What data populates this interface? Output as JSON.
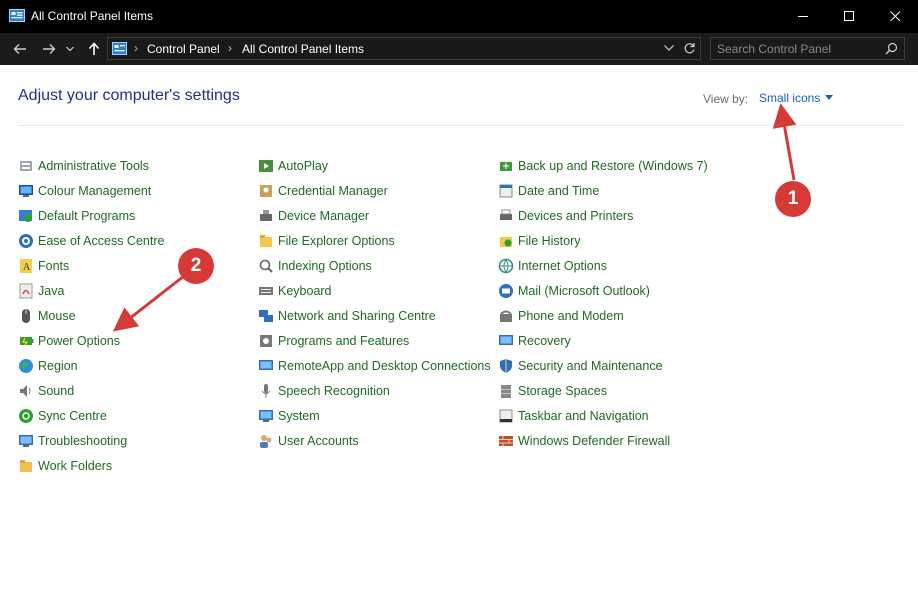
{
  "window": {
    "title": "All Control Panel Items"
  },
  "address": {
    "crumbs": [
      "Control Panel",
      "All Control Panel Items"
    ],
    "search_placeholder": "Search Control Panel"
  },
  "main": {
    "heading": "Adjust your computer's settings",
    "view_by_label": "View by:",
    "view_by_value": "Small icons"
  },
  "columns": [
    [
      {
        "label": "Administrative Tools",
        "icon": "administrative-tools-icon"
      },
      {
        "label": "Colour Management",
        "icon": "colour-management-icon"
      },
      {
        "label": "Default Programs",
        "icon": "default-programs-icon"
      },
      {
        "label": "Ease of Access Centre",
        "icon": "ease-of-access-icon"
      },
      {
        "label": "Fonts",
        "icon": "fonts-icon"
      },
      {
        "label": "Java",
        "icon": "java-icon"
      },
      {
        "label": "Mouse",
        "icon": "mouse-icon"
      },
      {
        "label": "Power Options",
        "icon": "power-options-icon"
      },
      {
        "label": "Region",
        "icon": "region-icon"
      },
      {
        "label": "Sound",
        "icon": "sound-icon"
      },
      {
        "label": "Sync Centre",
        "icon": "sync-centre-icon"
      },
      {
        "label": "Troubleshooting",
        "icon": "troubleshooting-icon"
      },
      {
        "label": "Work Folders",
        "icon": "work-folders-icon"
      }
    ],
    [
      {
        "label": "AutoPlay",
        "icon": "autoplay-icon"
      },
      {
        "label": "Credential Manager",
        "icon": "credential-manager-icon"
      },
      {
        "label": "Device Manager",
        "icon": "device-manager-icon"
      },
      {
        "label": "File Explorer Options",
        "icon": "file-explorer-options-icon"
      },
      {
        "label": "Indexing Options",
        "icon": "indexing-options-icon"
      },
      {
        "label": "Keyboard",
        "icon": "keyboard-icon"
      },
      {
        "label": "Network and Sharing Centre",
        "icon": "network-sharing-icon"
      },
      {
        "label": "Programs and Features",
        "icon": "programs-features-icon"
      },
      {
        "label": "RemoteApp and Desktop Connections",
        "icon": "remoteapp-icon"
      },
      {
        "label": "Speech Recognition",
        "icon": "speech-recognition-icon"
      },
      {
        "label": "System",
        "icon": "system-icon"
      },
      {
        "label": "User Accounts",
        "icon": "user-accounts-icon"
      }
    ],
    [
      {
        "label": "Back up and Restore (Windows 7)",
        "icon": "backup-restore-icon"
      },
      {
        "label": "Date and Time",
        "icon": "date-time-icon"
      },
      {
        "label": "Devices and Printers",
        "icon": "devices-printers-icon"
      },
      {
        "label": "File History",
        "icon": "file-history-icon"
      },
      {
        "label": "Internet Options",
        "icon": "internet-options-icon"
      },
      {
        "label": "Mail (Microsoft Outlook)",
        "icon": "mail-icon"
      },
      {
        "label": "Phone and Modem",
        "icon": "phone-modem-icon"
      },
      {
        "label": "Recovery",
        "icon": "recovery-icon"
      },
      {
        "label": "Security and Maintenance",
        "icon": "security-maintenance-icon"
      },
      {
        "label": "Storage Spaces",
        "icon": "storage-spaces-icon"
      },
      {
        "label": "Taskbar and Navigation",
        "icon": "taskbar-navigation-icon"
      },
      {
        "label": "Windows Defender Firewall",
        "icon": "firewall-icon"
      }
    ]
  ],
  "annotations": {
    "badge_1": "1",
    "badge_2": "2",
    "color": "#d63a36"
  }
}
